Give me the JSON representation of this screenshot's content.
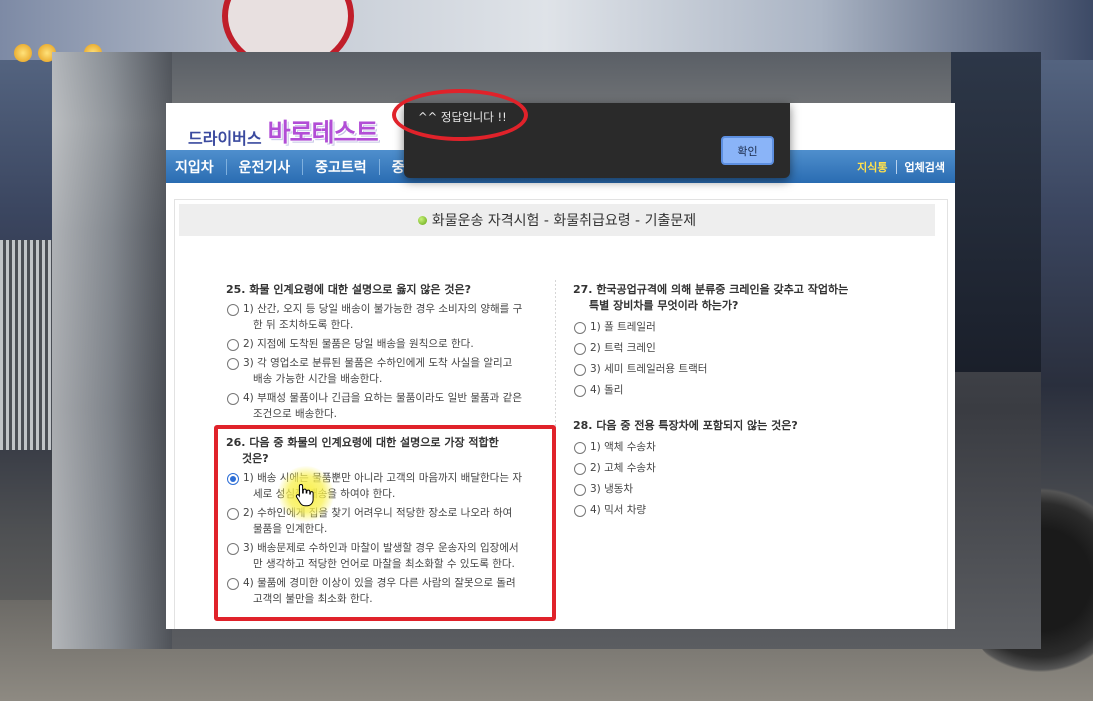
{
  "site": {
    "logo_small": "드라이버스",
    "logo_big": "바로테스트"
  },
  "nav": {
    "items": [
      "지입차",
      "운전기사",
      "중고트럭",
      "중"
    ],
    "right_knowledge": "지식통",
    "right_company": "업체검색"
  },
  "page_title": "화물운송 자격시험 - 화물취급요령 - 기출문제",
  "alert": {
    "message": "^^ 정답입니다 !!",
    "ok_label": "확인"
  },
  "questions": {
    "q25": {
      "title": "25. 화물 인계요령에 대한 설명으로 옳지 않은 것은?",
      "options": [
        "1) 산간, 오지 등 당일 배송이 불가능한 경우 소비자의 양해를 구\n   한 뒤 조치하도록 한다.",
        "2) 지점에 도착된 물품은 당일 배송을 원칙으로 한다.",
        "3) 각 영업소로 분류된 물품은 수하인에게 도착 사실을 알리고\n   배송 가능한 시간을 배송한다.",
        "4) 부패성 물품이나 긴급을 요하는 물품이라도 일반 물품과 같은\n   조건으로 배송한다."
      ]
    },
    "q26": {
      "title_line1": "26. 다음 중 화물의 인계요령에 대한 설명으로 가장 적합한",
      "title_line2": "것은?",
      "selected": 0,
      "options": [
        "1) 배송 시에는 물품뿐만 아니라 고객의 마음까지 배달한다는 자\n   세로 성심껏 배송을 하여야 한다.",
        "2) 수하인에게 집을 찾기 어려우니 적당한 장소로 나오라 하여\n   물품을 인계한다.",
        "3) 배송문제로 수하인과 마찰이 발생할 경우 운송자의 입장에서\n   만 생각하고 적당한 언어로 마찰을 최소화할 수 있도록 한다.",
        "4) 물품에 경미한 이상이 있을 경우 다른 사람의 잘못으로 돌려\n   고객의 불만을 최소화 한다."
      ]
    },
    "q27": {
      "title_line1": "27. 한국공업규격에 의해 분류중 크레인을 갖추고 작업하는",
      "title_line2": "특별 장비차를 무엇이라 하는가?",
      "options": [
        "1) 폴 트레일러",
        "2) 트럭 크레인",
        "3) 세미 트레일러용 트랙터",
        "4) 돌리"
      ]
    },
    "q28": {
      "title": "28. 다음 중 전용 특장차에 포함되지 않는 것은?",
      "options": [
        "1) 액체 수송차",
        "2) 고체 수송차",
        "3) 냉동차",
        "4) 믹서 차량"
      ]
    }
  }
}
